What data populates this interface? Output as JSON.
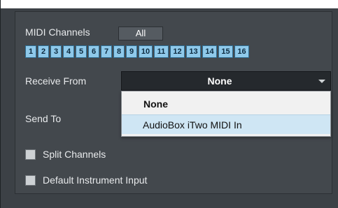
{
  "midi_channels": {
    "label": "MIDI Channels",
    "all_label": "All",
    "channels": [
      "1",
      "2",
      "3",
      "4",
      "5",
      "6",
      "7",
      "8",
      "9",
      "10",
      "11",
      "12",
      "13",
      "14",
      "15",
      "16"
    ]
  },
  "receive_from": {
    "label": "Receive From",
    "selected": "None"
  },
  "dropdown": {
    "options": [
      "None",
      "AudioBox iTwo MIDI In"
    ]
  },
  "send_to": {
    "label": "Send To"
  },
  "checkboxes": {
    "split_channels": "Split Channels",
    "default_instrument_input": "Default Instrument Input"
  },
  "colors": {
    "panel_bg": "#43484d",
    "channel_button": "#8fc9ea",
    "dropdown_highlight": "#cfe6f4"
  },
  "icons": {
    "dropdown_caret": "chevron-down-icon",
    "checkbox": "checkbox-icon"
  }
}
